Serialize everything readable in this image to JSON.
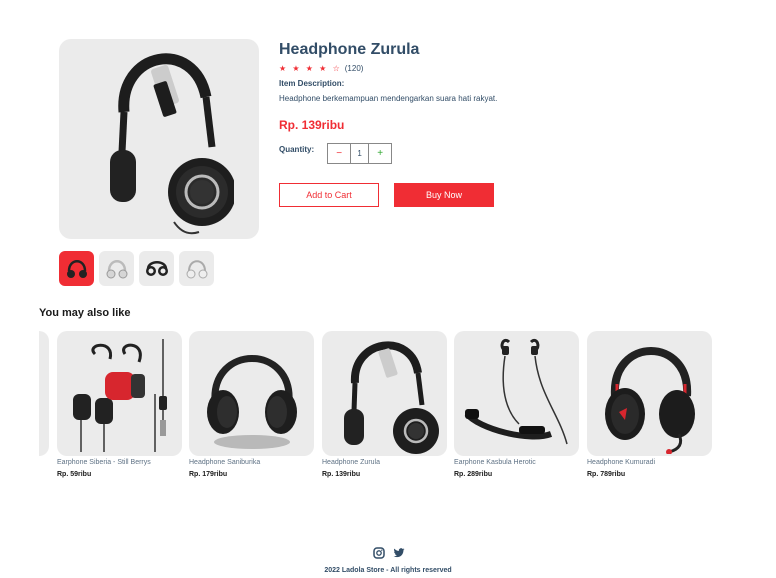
{
  "product": {
    "title": "Headphone Zurula",
    "stars": "★ ★ ★ ★ ☆",
    "rating_count": "(120)",
    "description_label": "Item Description:",
    "description": "Headphone berkemampuan mendengarkan suara hati rakyat.",
    "price": "Rp. 139ribu",
    "quantity_label": "Quantity:",
    "quantity": "1",
    "minus": "−",
    "plus": "+",
    "add_to_cart": "Add to Cart",
    "buy_now": "Buy Now"
  },
  "thumbnails": [
    "headphone-red",
    "headphone-white",
    "headphone-black",
    "headphone-silver"
  ],
  "related": {
    "title": "You may also like",
    "items": [
      {
        "name": "Earphone Siberia - Still Berrys",
        "price": "Rp. 59ribu",
        "icon": "earphone-icon"
      },
      {
        "name": "Headphone Saniburika",
        "price": "Rp. 179ribu",
        "icon": "headphone-icon"
      },
      {
        "name": "Headphone Zurula",
        "price": "Rp. 139ribu",
        "icon": "headphone-icon"
      },
      {
        "name": "Earphone Kasbula Herotic",
        "price": "Rp. 289ribu",
        "icon": "neckband-icon"
      },
      {
        "name": "Headphone Kumuradi",
        "price": "Rp. 789ribu",
        "icon": "headphone-icon"
      }
    ]
  },
  "footer": {
    "copyright": "2022 Ladola Store - All rights reserved",
    "icons": [
      "instagram-icon",
      "twitter-icon"
    ]
  },
  "colors": {
    "accent": "#f02d34",
    "text": "#324d67",
    "card_bg": "#ebebeb"
  }
}
